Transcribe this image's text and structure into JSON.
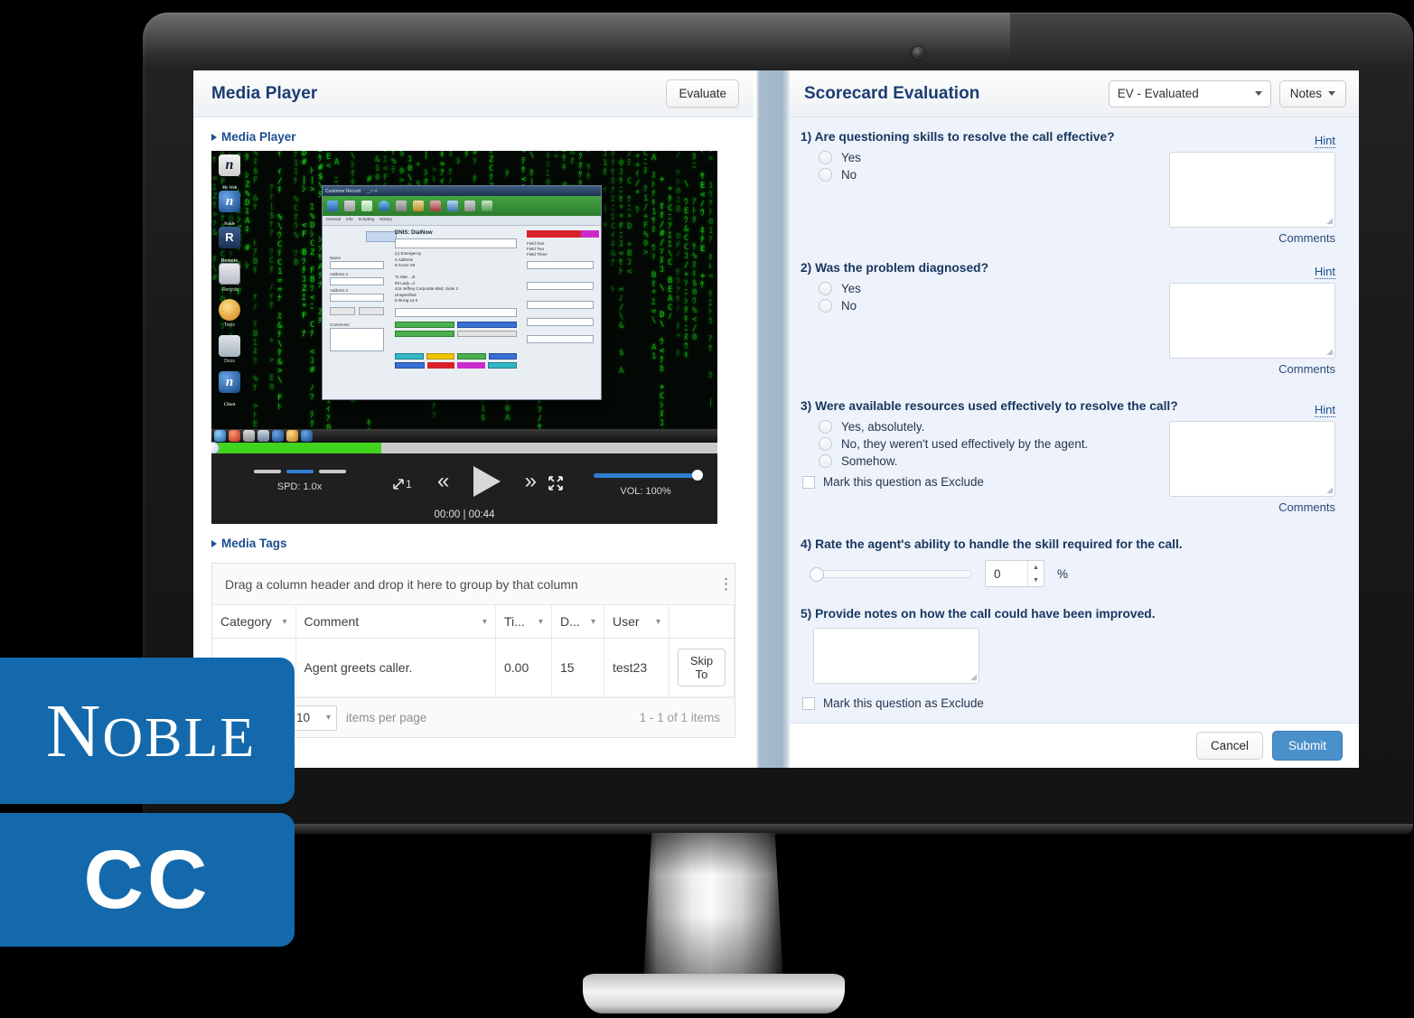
{
  "media_player": {
    "panel_title": "Media Player",
    "evaluate_label": "Evaluate",
    "section_media_player": "Media Player",
    "section_media_tags": "Media Tags",
    "controls": {
      "speed_label": "SPD: 1.0x",
      "zoom_label": "1",
      "time_label": "00:00 | 00:44",
      "volume_label": "VOL: 100%",
      "rewind_icon": "double-chevron-left",
      "play_icon": "play-triangle",
      "forward_icon": "double-chevron-right",
      "fullscreen_icon": "expand-arrows",
      "expand_icon": "diagonal-arrow"
    }
  },
  "grid": {
    "group_hint": "Drag a column header and drop it here to group by that column",
    "kebab_icon": "vertical-ellipsis-icon",
    "columns": [
      "Category",
      "Comment",
      "Ti...",
      "D...",
      "User",
      ""
    ],
    "rows": [
      {
        "category": "",
        "comment": "Agent greets caller.",
        "time": "0.00",
        "duration": "15",
        "user": "test23",
        "action": "Skip To"
      }
    ],
    "pager": {
      "next_icon": "play-right-icon",
      "last_icon": "skip-last-icon",
      "page_size": "10",
      "items_per_page": "items per page",
      "range": "1 - 1 of 1 items"
    }
  },
  "scorecard": {
    "panel_title": "Scorecard Evaluation",
    "status_value": "EV - Evaluated",
    "notes_label": "Notes",
    "hint_label": "Hint",
    "comments_label": "Comments",
    "exclude_label": "Mark this question as Exclude",
    "percent_symbol": "%",
    "questions": [
      {
        "text": "1) Are questioning skills to resolve the call effective?",
        "type": "radio",
        "options": [
          "Yes",
          "No"
        ],
        "has_hint": true,
        "has_comments": true,
        "has_exclude": false,
        "comment_value": ""
      },
      {
        "text": "2) Was the problem diagnosed?",
        "type": "radio",
        "options": [
          "Yes",
          "No"
        ],
        "has_hint": true,
        "has_comments": true,
        "has_exclude": false,
        "comment_value": ""
      },
      {
        "text": "3) Were available resources used effectively to resolve the call?",
        "type": "radio",
        "options": [
          "Yes, absolutely.",
          "No, they weren't used effectively by the agent.",
          "Somehow."
        ],
        "has_hint": true,
        "has_comments": true,
        "has_exclude": true,
        "comment_value": ""
      },
      {
        "text": "4) Rate the agent's ability to handle the skill required for the call.",
        "type": "slider",
        "slider_value": "0",
        "slider_percent": 0,
        "has_hint": false,
        "has_comments": false,
        "has_exclude": false
      },
      {
        "text": "5) Provide notes on how the call could have been improved.",
        "type": "textarea",
        "value": "",
        "has_hint": false,
        "has_comments": false,
        "has_exclude": true
      }
    ],
    "cancel_label": "Cancel",
    "submit_label": "Submit"
  },
  "branding": {
    "noble_first": "N",
    "noble_rest": "OBLE",
    "cc": "CC",
    "brand_color": "#1369ab"
  },
  "video_content": {
    "desktop_theme": "matrix-green-code-wallpaper",
    "app_window_title": "Customer Record",
    "app_section_label": "DNIS: DialNow"
  }
}
